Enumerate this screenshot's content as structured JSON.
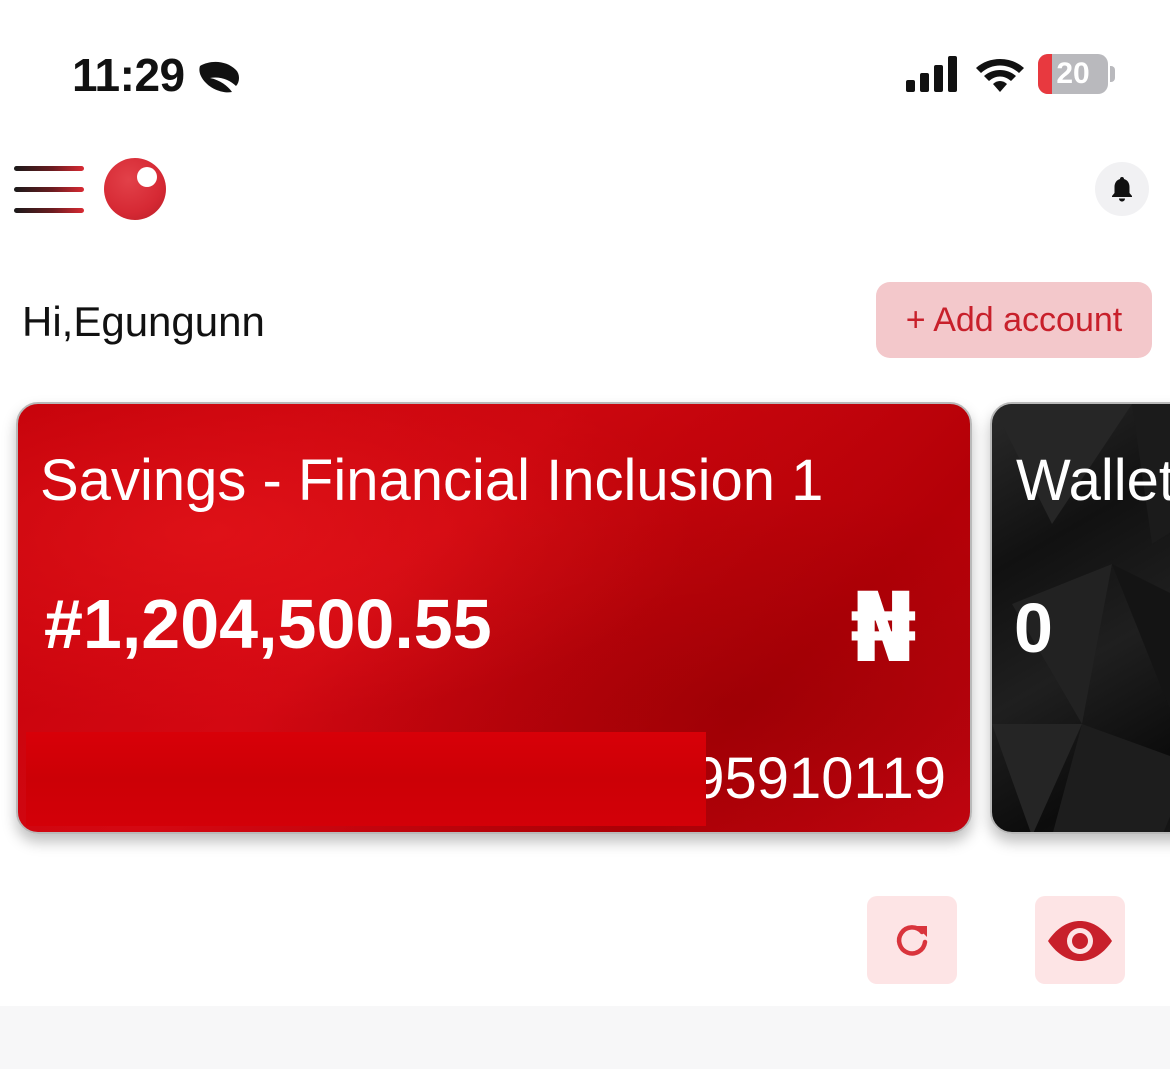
{
  "status_bar": {
    "time": "11:29",
    "battery_level": "20",
    "battery_fraction": 0.2,
    "icons": [
      "moon-leaf-icon",
      "cellular-signal-icon",
      "wifi-icon",
      "battery-icon"
    ]
  },
  "header": {
    "menu_icon": "hamburger-menu-icon",
    "logo": "brand-logo",
    "notification_icon": "bell-icon"
  },
  "greeting": {
    "text": "Hi,Egungunn",
    "add_account_label": "+ Add account"
  },
  "cards": {
    "savings": {
      "title": "Savings - Financial Inclusion 1",
      "amount": "#1,204,500.55",
      "currency_symbol": "₦",
      "account_number": "95910119"
    },
    "wallet": {
      "title": "Wallet",
      "amount": "0"
    }
  },
  "actions": {
    "refresh_icon": "refresh-icon",
    "visibility_icon": "eye-icon"
  },
  "colors": {
    "brand_red": "#d62934",
    "button_tint": "#f3c8cb",
    "action_tint": "#fde4e5"
  }
}
